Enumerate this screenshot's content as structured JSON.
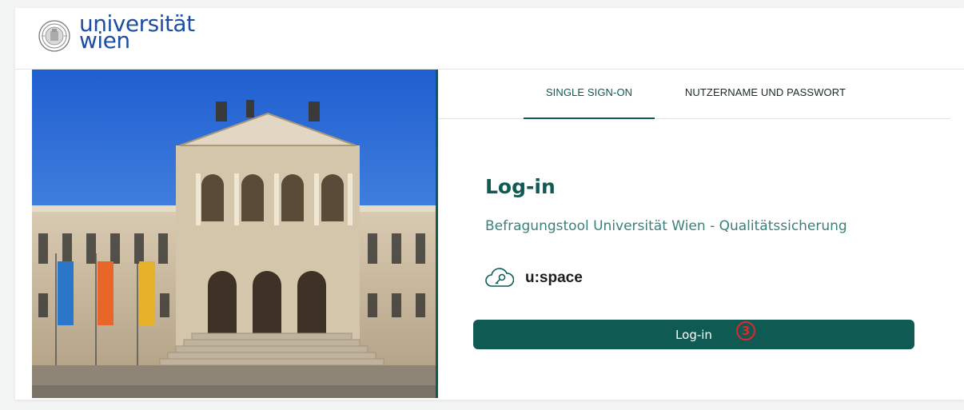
{
  "header": {
    "logo_line1": "universität",
    "logo_line2": "wien",
    "seal_icon": "university-seal-icon"
  },
  "tabs": [
    {
      "label": "SINGLE SIGN-ON",
      "active": true
    },
    {
      "label": "NUTZERNAME UND PASSWORT",
      "active": false
    }
  ],
  "login": {
    "title": "Log-in",
    "subtitle": "Befragungstool Universität Wien - Qualitätssicherung",
    "provider_icon": "cloud-key-icon",
    "provider_label": "u:space",
    "button_label": "Log-in",
    "step_badge": "3"
  },
  "colors": {
    "brand_green": "#0f5a53",
    "logo_blue": "#1e4ea1",
    "badge_red": "#e3262b",
    "subtitle_green": "#3b807a"
  }
}
